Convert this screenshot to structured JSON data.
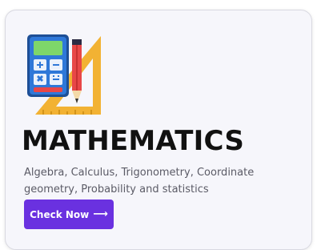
{
  "card": {
    "title": "MATHEMATICS",
    "description": "Algebra, Calculus, Trigonometry, Coordinate geometry, Probability and statistics",
    "cta_label": "Check Now",
    "cta_icon": "arrow-right-icon",
    "illustration_icon": "calculator-pencil-ruler-icon"
  },
  "colors": {
    "card_background": "#f6f6fb",
    "button_background": "#6a31e0",
    "button_text": "#ffffff",
    "title_text": "#111111",
    "description_text": "#5b5b66",
    "calculator_body": "#2f78d8",
    "calculator_screen": "#7ed66a",
    "ruler": "#f2b233",
    "pencil": "#e84747"
  }
}
